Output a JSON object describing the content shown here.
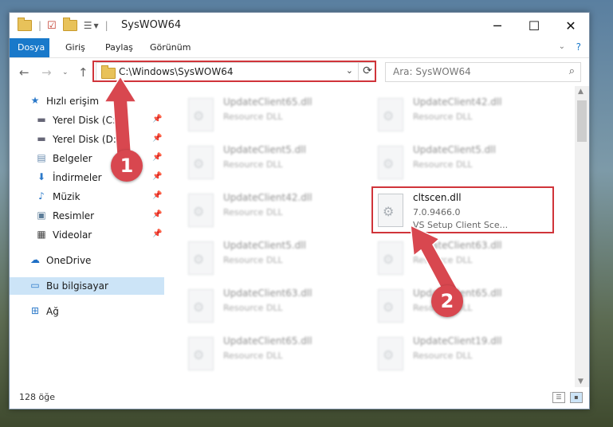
{
  "window": {
    "title": "SysWOW64",
    "minimize_glyph": "─",
    "maximize_glyph": "☐",
    "close_glyph": "✕"
  },
  "ribbon": {
    "tabs": [
      {
        "label": "Dosya",
        "active": true
      },
      {
        "label": "Giriş",
        "active": false
      },
      {
        "label": "Paylaş",
        "active": false
      },
      {
        "label": "Görünüm",
        "active": false
      }
    ]
  },
  "address": {
    "path": "C:\\Windows\\SysWOW64",
    "search_placeholder": "Ara: SysWOW64"
  },
  "sidebar": {
    "items": [
      {
        "label": "Hızlı erişim",
        "icon": "star-icon"
      },
      {
        "label": "Yerel Disk (C:)",
        "icon": "drive-icon"
      },
      {
        "label": "Yerel Disk (D:)",
        "icon": "drive-icon"
      },
      {
        "label": "Belgeler",
        "icon": "documents-icon"
      },
      {
        "label": "İndirmeler",
        "icon": "download-icon"
      },
      {
        "label": "Müzik",
        "icon": "music-icon"
      },
      {
        "label": "Resimler",
        "icon": "pictures-icon"
      },
      {
        "label": "Videolar",
        "icon": "video-icon"
      },
      {
        "label": "OneDrive",
        "icon": "cloud-icon"
      },
      {
        "label": "Bu bilgisayar",
        "icon": "computer-icon"
      },
      {
        "label": "Ağ",
        "icon": "network-icon"
      }
    ]
  },
  "files": [
    {
      "name": "UpdateClient65.dll",
      "desc": "Resource DLL"
    },
    {
      "name": "UpdateClient42.dll",
      "desc": "Resource DLL"
    },
    {
      "name": "UpdateClient5.dll",
      "desc": "Resource DLL"
    },
    {
      "name": "UpdateClient5.dll",
      "desc": "Resource DLL"
    },
    {
      "name": "UpdateClient42.dll",
      "desc": "Resource DLL"
    },
    {
      "name": "cltscen.dll",
      "version": "7.0.9466.0",
      "desc": "VS Setup Client Sce..."
    },
    {
      "name": "UpdateClient5.dll",
      "desc": "Resource DLL"
    },
    {
      "name": "UpdateClient63.dll",
      "desc": "Resource DLL"
    },
    {
      "name": "UpdateClient63.dll",
      "desc": "Resource DLL"
    },
    {
      "name": "UpdateClient65.dll",
      "desc": "Resource DLL"
    },
    {
      "name": "UpdateClient65.dll",
      "desc": "Resource DLL"
    },
    {
      "name": "UpdateClient19.dll",
      "desc": "Resource DLL"
    }
  ],
  "status": {
    "item_count": "128 öğe"
  },
  "annotations": {
    "badge1": "1",
    "badge2": "2",
    "color": "#d8474f"
  }
}
